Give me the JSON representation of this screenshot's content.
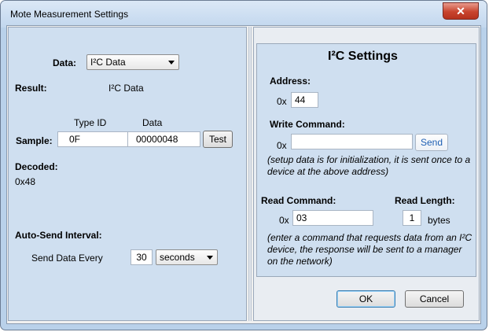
{
  "window": {
    "title": "Mote Measurement Settings",
    "close_glyph": "✕"
  },
  "left": {
    "data_label": "Data:",
    "data_select": "I²C Data",
    "result_label": "Result:",
    "result_value": "I²C Data",
    "type_id_header": "Type ID",
    "data_header": "Data",
    "sample_label": "Sample:",
    "sample_type_id": "0F",
    "sample_data": "00000048",
    "test_button": "Test",
    "decoded_label": "Decoded:",
    "decoded_value": "0x48",
    "auto_send_label": "Auto-Send Interval:",
    "send_every_label": "Send Data Every",
    "send_every_value": "30",
    "unit_select": "seconds"
  },
  "right": {
    "heading": "I²C Settings",
    "address_label": "Address:",
    "address_prefix": "0x",
    "address_value": "44",
    "write_label": "Write Command:",
    "write_prefix": "0x",
    "write_value": "",
    "send_button": "Send",
    "write_note": "(setup data is for initialization, it is sent once to a device at the above address)",
    "read_label": "Read Command:",
    "read_prefix": "0x",
    "read_value": "03",
    "read_length_label": "Read Length:",
    "read_length_value": "1",
    "bytes_label": "bytes",
    "read_note": "(enter a command that requests data from an I²C device, the response will be sent to a manager on the network)",
    "ok_button": "OK",
    "cancel_button": "Cancel"
  },
  "colors": {
    "frame": "#b9d1ea",
    "panel": "#cfdff0",
    "close_button": "#c8442e",
    "send_text": "#1d5fb3"
  }
}
